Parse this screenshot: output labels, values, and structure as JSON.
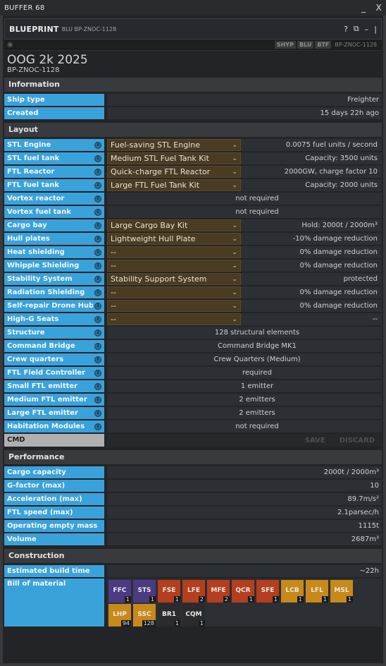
{
  "window": {
    "title": "BUFFER 68",
    "minimize": "_",
    "close": "X"
  },
  "tile": {
    "command": "BLUEPRINT",
    "command_sub": "BLU BP-ZNOC-1128",
    "help": "?",
    "popout": "⧉",
    "minimize": "–",
    "close": "|"
  },
  "subbar": {
    "tags": [
      "SHYP",
      "BLU",
      "BTF"
    ],
    "ref": "BP-ZNOC-1128"
  },
  "blueprint": {
    "name": "OOG 2k 2025",
    "id": "BP-ZNOC-1128"
  },
  "sections": {
    "information": "Information",
    "layout": "Layout",
    "performance": "Performance",
    "construction": "Construction"
  },
  "information": [
    {
      "label": "Ship type",
      "value": "Freighter"
    },
    {
      "label": "Created",
      "value": "15 days 22h ago"
    }
  ],
  "layout_selects": [
    {
      "label": "STL Engine",
      "selected": "Fuel-saving STL Engine",
      "effect": "0.0075 fuel units / second"
    },
    {
      "label": "STL fuel tank",
      "selected": "Medium STL Fuel Tank Kit",
      "effect": "Capacity: 3500 units"
    },
    {
      "label": "FTL Reactor",
      "selected": "Quick-charge FTL Reactor",
      "effect": "2000GW, charge factor 10"
    },
    {
      "label": "FTL fuel tank",
      "selected": "Large FTL Fuel Tank Kit",
      "effect": "Capacity: 2000 units"
    }
  ],
  "layout_static_a": [
    {
      "label": "Vortex reactor",
      "value": "not required"
    },
    {
      "label": "Vortex fuel tank",
      "value": "not required"
    }
  ],
  "layout_selects_b": [
    {
      "label": "Cargo bay",
      "selected": "Large Cargo Bay Kit",
      "effect": "Hold: 2000t / 2000m³"
    },
    {
      "label": "Hull plates",
      "selected": "Lightweight Hull Plate",
      "effect": "-10% damage reduction"
    },
    {
      "label": "Heat shielding",
      "selected": "--",
      "effect": "0% damage reduction"
    },
    {
      "label": "Whipple Shielding",
      "selected": "--",
      "effect": "0% damage reduction"
    },
    {
      "label": "Stability System",
      "selected": "Stability Support System",
      "effect": "protected"
    },
    {
      "label": "Radiation Shielding",
      "selected": "--",
      "effect": "0% damage reduction"
    },
    {
      "label": "Self-repair Drone Hub",
      "selected": "--",
      "effect": "0% damage reduction"
    },
    {
      "label": "High-G Seats",
      "selected": "--",
      "effect": "--"
    }
  ],
  "layout_static_b": [
    {
      "label": "Structure",
      "value": "128 structural elements"
    },
    {
      "label": "Command Bridge",
      "value": "Command Bridge MK1"
    },
    {
      "label": "Crew quarters",
      "value": "Crew Quarters (Medium)"
    },
    {
      "label": "FTL Field Controller",
      "value": "required"
    },
    {
      "label": "Small FTL emitter",
      "value": "1 emitter"
    },
    {
      "label": "Medium FTL emitter",
      "value": "2 emitters"
    },
    {
      "label": "Large FTL emitter",
      "value": "2 emitters"
    },
    {
      "label": "Habitation Modules",
      "value": "not required"
    }
  ],
  "cmd": {
    "label": "CMD",
    "save": "SAVE",
    "discard": "DISCARD"
  },
  "performance": [
    {
      "label": "Cargo capacity",
      "value": "2000t / 2000m³"
    },
    {
      "label": "G-factor (max)",
      "value": "10"
    },
    {
      "label": "Acceleration (max)",
      "value": "89.7m/s²"
    },
    {
      "label": "FTL speed (max)",
      "value": "2.1parsec/h"
    },
    {
      "label": "Operating empty mass",
      "value": "1115t"
    },
    {
      "label": "Volume",
      "value": "2687m³"
    }
  ],
  "construction": {
    "build_time_label": "Estimated build time",
    "build_time": "~22h",
    "bom_label": "Bill of material",
    "materials": [
      {
        "ticker": "FFC",
        "count": "1",
        "color": "#4a3b82"
      },
      {
        "ticker": "STS",
        "count": "1",
        "color": "#4a3b82"
      },
      {
        "ticker": "FSE",
        "count": "1",
        "color": "#b43e1d"
      },
      {
        "ticker": "LFE",
        "count": "2",
        "color": "#b43e1d"
      },
      {
        "ticker": "MFE",
        "count": "2",
        "color": "#b43e1d"
      },
      {
        "ticker": "QCR",
        "count": "1",
        "color": "#b43e1d"
      },
      {
        "ticker": "SFE",
        "count": "1",
        "color": "#b43e1d"
      },
      {
        "ticker": "LCB",
        "count": "1",
        "color": "#c7891a"
      },
      {
        "ticker": "LFL",
        "count": "1",
        "color": "#c7891a"
      },
      {
        "ticker": "MSL",
        "count": "1",
        "color": "#c7891a"
      },
      {
        "ticker": "LHP",
        "count": "94",
        "color": "#c7891a"
      },
      {
        "ticker": "SSC",
        "count": "128",
        "color": "#c7891a"
      },
      {
        "ticker": "BR1",
        "count": "1",
        "color": "#2b2b2d"
      },
      {
        "ticker": "CQM",
        "count": "1",
        "color": "#2b2b2d"
      }
    ]
  }
}
